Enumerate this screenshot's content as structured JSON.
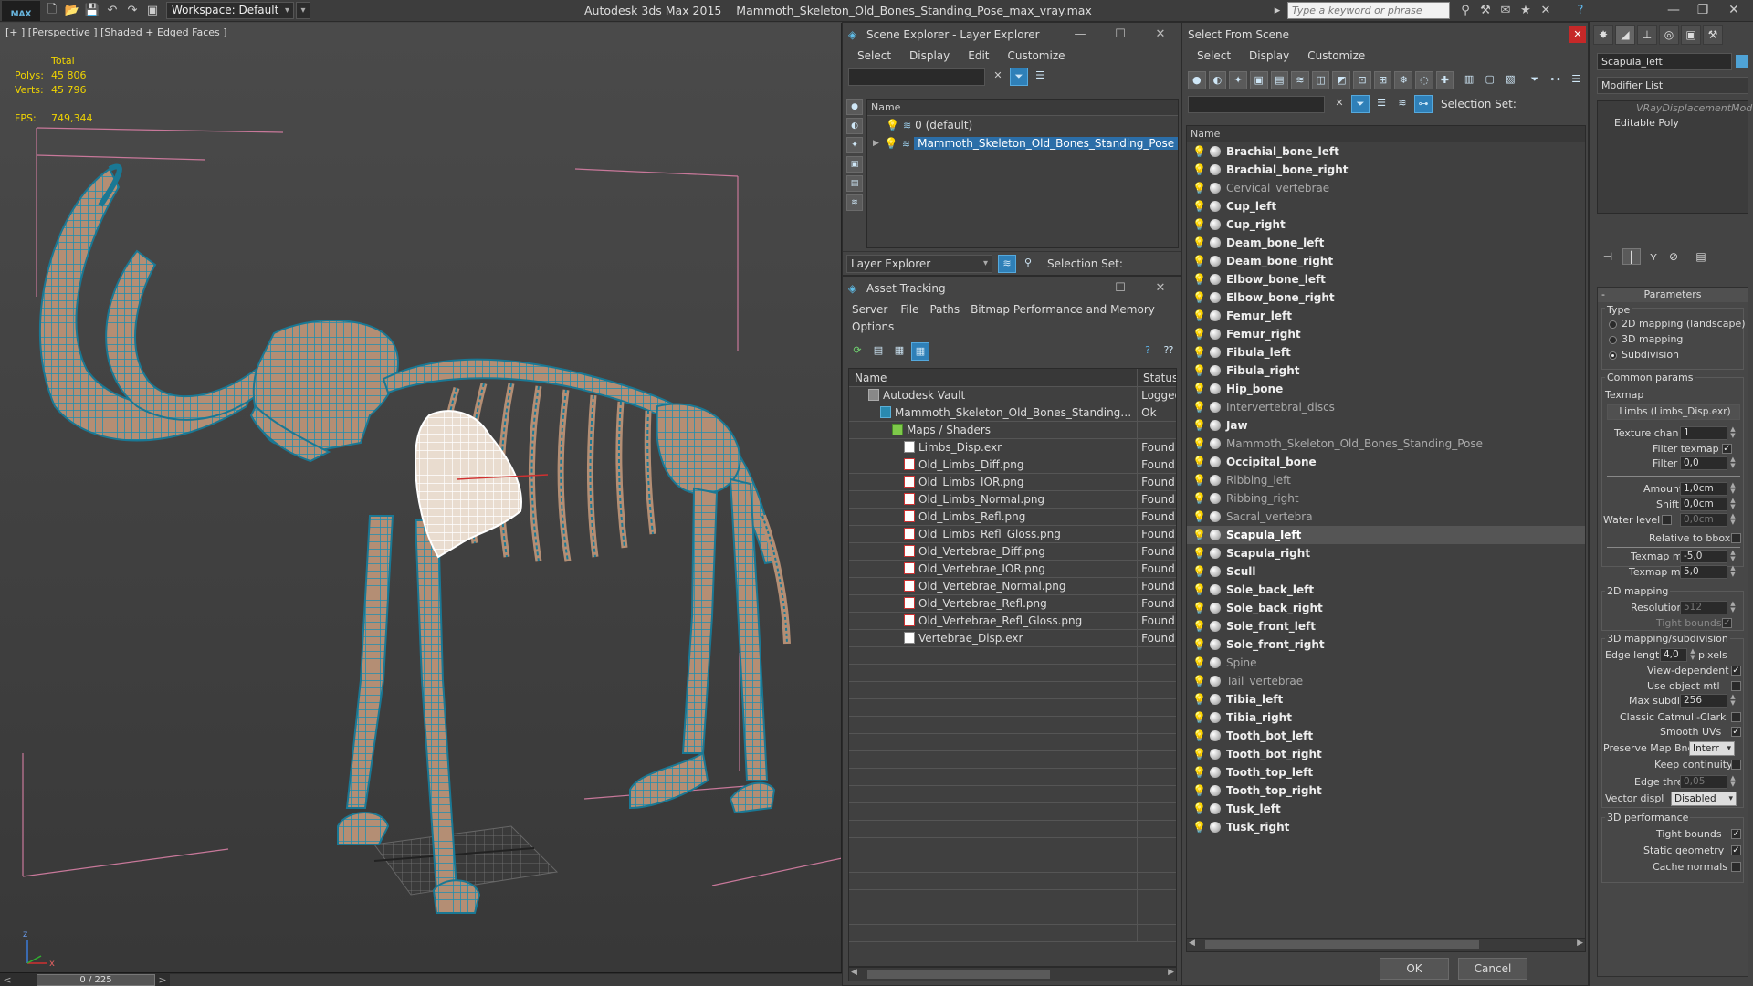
{
  "titlebar": {
    "logo": "MAX",
    "workspace": "Workspace: Default",
    "app_name": "Autodesk 3ds Max  2015",
    "file_name": "Mammoth_Skeleton_Old_Bones_Standing_Pose_max_vray.max",
    "search_placeholder": "Type a keyword or phrase"
  },
  "viewport": {
    "label": "[+ ] [Perspective ] [Shaded + Edged Faces ]",
    "stats_total": "Total",
    "polys_label": "Polys:",
    "polys_value": "45 806",
    "verts_label": "Verts:",
    "verts_value": "45 796",
    "fps_label": "FPS:",
    "fps_value": "749,344",
    "timeline_pos": "0 / 225",
    "timeline_prev": "<",
    "timeline_next": ">"
  },
  "scene_explorer": {
    "title": "Scene Explorer - Layer Explorer",
    "menu": [
      "Select",
      "Display",
      "Edit",
      "Customize"
    ],
    "col_name": "Name",
    "layers": [
      {
        "name": "0 (default)",
        "selected": false
      },
      {
        "name": "Mammoth_Skeleton_Old_Bones_Standing_Pose",
        "selected": true
      }
    ],
    "bottom_dropdown": "Layer Explorer",
    "selection_set_label": "Selection Set:"
  },
  "asset_tracking": {
    "title": "Asset Tracking",
    "menu": [
      "Server",
      "File",
      "Paths",
      "Bitmap Performance and Memory"
    ],
    "menu2": "Options",
    "col_name": "Name",
    "col_status": "Status",
    "rows": [
      {
        "name": "Autodesk Vault",
        "status": "Logged",
        "indent": 1,
        "icon": "vault"
      },
      {
        "name": "Mammoth_Skeleton_Old_Bones_Standing_Pose...",
        "status": "Ok",
        "indent": 2,
        "icon": "max"
      },
      {
        "name": "Maps / Shaders",
        "status": "",
        "indent": 3,
        "icon": "fold"
      },
      {
        "name": "Limbs_Disp.exr",
        "status": "Found",
        "indent": 4,
        "icon": "exr"
      },
      {
        "name": "Old_Limbs_Diff.png",
        "status": "Found",
        "indent": 4,
        "icon": "png"
      },
      {
        "name": "Old_Limbs_IOR.png",
        "status": "Found",
        "indent": 4,
        "icon": "png"
      },
      {
        "name": "Old_Limbs_Normal.png",
        "status": "Found",
        "indent": 4,
        "icon": "png"
      },
      {
        "name": "Old_Limbs_Refl.png",
        "status": "Found",
        "indent": 4,
        "icon": "png"
      },
      {
        "name": "Old_Limbs_Refl_Gloss.png",
        "status": "Found",
        "indent": 4,
        "icon": "png"
      },
      {
        "name": "Old_Vertebrae_Diff.png",
        "status": "Found",
        "indent": 4,
        "icon": "png"
      },
      {
        "name": "Old_Vertebrae_IOR.png",
        "status": "Found",
        "indent": 4,
        "icon": "png"
      },
      {
        "name": "Old_Vertebrae_Normal.png",
        "status": "Found",
        "indent": 4,
        "icon": "png"
      },
      {
        "name": "Old_Vertebrae_Refl.png",
        "status": "Found",
        "indent": 4,
        "icon": "png"
      },
      {
        "name": "Old_Vertebrae_Refl_Gloss.png",
        "status": "Found",
        "indent": 4,
        "icon": "png"
      },
      {
        "name": "Vertebrae_Disp.exr",
        "status": "Found",
        "indent": 4,
        "icon": "exr"
      }
    ]
  },
  "select_from_scene": {
    "title": "Select From Scene",
    "menu": [
      "Select",
      "Display",
      "Customize"
    ],
    "selection_set_label": "Selection Set:",
    "col_name": "Name",
    "ok_label": "OK",
    "cancel_label": "Cancel",
    "objects": [
      {
        "name": "Brachial_bone_left",
        "style": "bold"
      },
      {
        "name": "Brachial_bone_right",
        "style": "bold"
      },
      {
        "name": "Cervical_vertebrae",
        "style": "light"
      },
      {
        "name": "Cup_left",
        "style": "bold"
      },
      {
        "name": "Cup_right",
        "style": "bold"
      },
      {
        "name": "Deam_bone_left",
        "style": "bold"
      },
      {
        "name": "Deam_bone_right",
        "style": "bold"
      },
      {
        "name": "Elbow_bone_left",
        "style": "bold"
      },
      {
        "name": "Elbow_bone_right",
        "style": "bold"
      },
      {
        "name": "Femur_left",
        "style": "bold"
      },
      {
        "name": "Femur_right",
        "style": "bold"
      },
      {
        "name": "Fibula_left",
        "style": "bold"
      },
      {
        "name": "Fibula_right",
        "style": "bold"
      },
      {
        "name": "Hip_bone",
        "style": "bold"
      },
      {
        "name": "Intervertebral_discs",
        "style": "light"
      },
      {
        "name": "Jaw",
        "style": "bold"
      },
      {
        "name": "Mammoth_Skeleton_Old_Bones_Standing_Pose",
        "style": "light"
      },
      {
        "name": "Occipital_bone",
        "style": "bold"
      },
      {
        "name": "Ribbing_left",
        "style": "light"
      },
      {
        "name": "Ribbing_right",
        "style": "light"
      },
      {
        "name": "Sacral_vertebra",
        "style": "light"
      },
      {
        "name": "Scapula_left",
        "style": "sel"
      },
      {
        "name": "Scapula_right",
        "style": "bold"
      },
      {
        "name": "Scull",
        "style": "bold"
      },
      {
        "name": "Sole_back_left",
        "style": "bold"
      },
      {
        "name": "Sole_back_right",
        "style": "bold"
      },
      {
        "name": "Sole_front_left",
        "style": "bold"
      },
      {
        "name": "Sole_front_right",
        "style": "bold"
      },
      {
        "name": "Spine",
        "style": "light"
      },
      {
        "name": "Tail_vertebrae",
        "style": "light"
      },
      {
        "name": "Tibia_left",
        "style": "bold"
      },
      {
        "name": "Tibia_right",
        "style": "bold"
      },
      {
        "name": "Tooth_bot_left",
        "style": "bold"
      },
      {
        "name": "Tooth_bot_right",
        "style": "bold"
      },
      {
        "name": "Tooth_top_left",
        "style": "bold"
      },
      {
        "name": "Tooth_top_right",
        "style": "bold"
      },
      {
        "name": "Tusk_left",
        "style": "bold"
      },
      {
        "name": "Tusk_right",
        "style": "bold"
      }
    ]
  },
  "command_panel": {
    "object_name": "Scapula_left",
    "modifier_list": "Modifier List",
    "stack": [
      "VRayDisplacementMod",
      "Editable Poly"
    ],
    "parameters_title": "Parameters",
    "type_label": "Type",
    "type_options": [
      "2D mapping (landscape)",
      "3D mapping",
      "Subdivision"
    ],
    "common_params": "Common params",
    "texmap_label": "Texmap",
    "texmap_value": "Limbs (Limbs_Disp.exr)",
    "texture_chan_label": "Texture chan",
    "texture_chan_value": "1",
    "filter_texmap_label": "Filter texmap",
    "filter_blur_label": "Filter blur",
    "filter_blur_value": "0,0",
    "amount_label": "Amount",
    "amount_value": "1,0cm",
    "shift_label": "Shift",
    "shift_value": "0,0cm",
    "water_level_label": "Water level",
    "water_level_value": "0,0cm",
    "relative_bbox_label": "Relative to bbox",
    "texmap_min_label": "Texmap min",
    "texmap_min_value": "-5,0",
    "texmap_max_label": "Texmap max",
    "texmap_max_value": "5,0",
    "mapping2d_title": "2D mapping",
    "resolution_label": "Resolution",
    "resolution_value": "512",
    "tight_bounds_label": "Tight bounds",
    "mapping3d_title": "3D mapping/subdivision",
    "edge_length_label": "Edge length",
    "edge_length_value": "4,0",
    "pixels_label": "pixels",
    "view_dependent_label": "View-dependent",
    "use_object_mtl_label": "Use object mtl",
    "max_subdivs_label": "Max subdivs",
    "max_subdivs_value": "256",
    "classic_catmull_label": "Classic Catmull-Clark",
    "smooth_uvs_label": "Smooth UVs",
    "preserve_map_label": "Preserve Map Bnd",
    "preserve_map_value": "Interr",
    "keep_continuity_label": "Keep continuity",
    "edge_thresh_label": "Edge thresh",
    "edge_thresh_value": "0,05",
    "vector_displ_label": "Vector displ",
    "vector_displ_value": "Disabled",
    "perf3d_title": "3D performance",
    "tight_bounds2_label": "Tight bounds",
    "static_geometry_label": "Static geometry",
    "cache_normals_label": "Cache normals"
  }
}
